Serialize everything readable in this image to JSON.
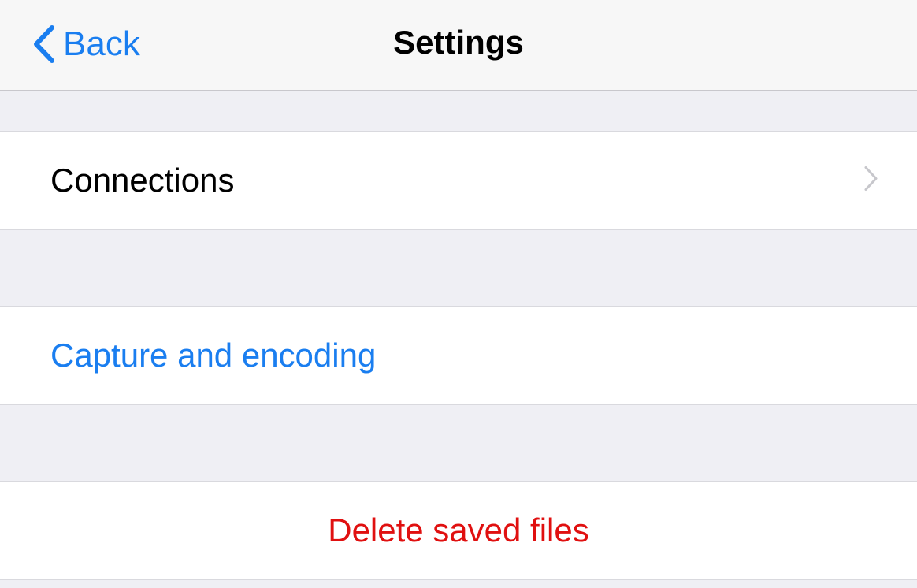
{
  "nav": {
    "back_label": "Back",
    "title": "Settings"
  },
  "rows": {
    "connections": "Connections",
    "capture": "Capture and encoding",
    "delete": "Delete saved files"
  },
  "colors": {
    "accent": "#1a7ef0",
    "destructive": "#e01010",
    "background": "#efeff4"
  },
  "icons": {
    "back": "chevron-left-icon",
    "disclosure": "chevron-right-icon"
  }
}
